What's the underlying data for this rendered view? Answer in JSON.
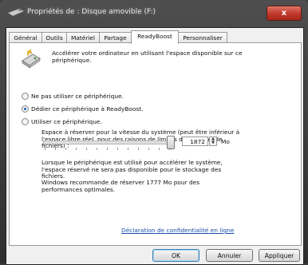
{
  "window": {
    "title": "Propriétés de : Disque amovible (F:)",
    "close_label": "x"
  },
  "tabs": [
    {
      "label": "Général",
      "active": false
    },
    {
      "label": "Outils",
      "active": false
    },
    {
      "label": "Matériel",
      "active": false
    },
    {
      "label": "Partage",
      "active": false
    },
    {
      "label": "ReadyBoost",
      "active": true
    },
    {
      "label": "Personnaliser",
      "active": false
    }
  ],
  "readyboost": {
    "intro": "Accélérer votre ordinateur en utilisant l'espace disponible sur ce périphérique.",
    "options": [
      {
        "label": "Ne pas utiliser ce périphérique.",
        "selected": false
      },
      {
        "label": "Dédier ce périphérique à ReadyBoost.",
        "selected": true
      },
      {
        "label": "Utiliser ce périphérique.",
        "selected": false
      }
    ],
    "reserve_label": "Espace à réserver pour la vitesse du système (peut être inférieur à l'espace libre réel, pour des raisons de limites de système de fichiers) :",
    "reserve_value": "1872",
    "reserve_unit": "Mo",
    "reserve_level": 1.0,
    "note_1": "Lorsque le périphérique est utilisé pour accélérer le système, l'espace réservé ne sera pas disponible pour le stockage des fichiers.",
    "note_2": "Windows recommande de réserver 1777 Mo pour des performances optimales.",
    "privacy_link": "Déclaration de confidentialité en ligne"
  },
  "buttons": {
    "ok": "OK",
    "cancel": "Annuler",
    "apply": "Appliquer"
  },
  "colors": {
    "link": "#1a4fa8",
    "selection": "#1d5fb4",
    "close": "#c0392b"
  }
}
